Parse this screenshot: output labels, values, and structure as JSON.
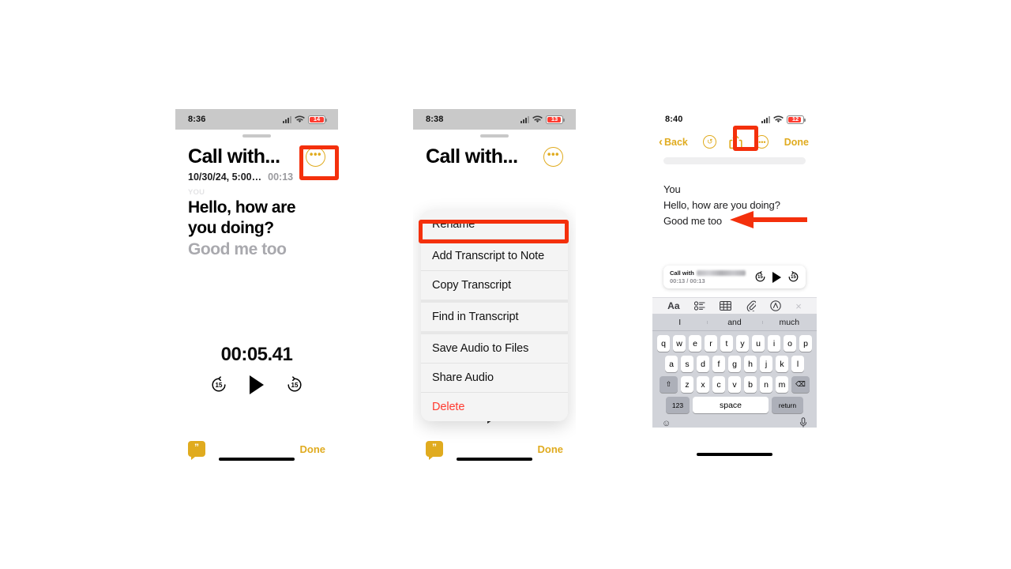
{
  "phone1": {
    "status": {
      "time": "8:36",
      "battery_level": "14"
    },
    "recording": {
      "title": "Call with...",
      "date": "10/30/24, 5:00…",
      "duration": "00:13",
      "speaker_label": "YOU",
      "transcript_spoken": "Hello, how are you doing?",
      "transcript_pending": "Good me too"
    },
    "player": {
      "current_time": "00:05.41",
      "skip_back_label": "15",
      "skip_forward_label": "15"
    },
    "bottom": {
      "done_label": "Done"
    }
  },
  "phone2": {
    "status": {
      "time": "8:38",
      "battery_level": "13"
    },
    "recording": {
      "title": "Call with..."
    },
    "menu": {
      "items": [
        {
          "label": "Rename",
          "danger": false
        },
        {
          "label": "Add Transcript to Note",
          "danger": false
        },
        {
          "label": "Copy Transcript",
          "danger": false
        },
        {
          "label": "Find in Transcript",
          "danger": false
        },
        {
          "label": "Save Audio to Files",
          "danger": false
        },
        {
          "label": "Share Audio",
          "danger": false
        },
        {
          "label": "Delete",
          "danger": true
        }
      ]
    },
    "bottom": {
      "done_label": "Done"
    }
  },
  "phone3": {
    "status": {
      "time": "8:40",
      "battery_level": "12"
    },
    "nav": {
      "back_label": "Back",
      "done_label": "Done",
      "undo_icon": "undo-icon",
      "share_icon": "share-icon",
      "more_icon": "more-icon"
    },
    "note": {
      "lines": [
        "You",
        "Hello, how are you doing?",
        "Good me too"
      ]
    },
    "audio_chip": {
      "title_prefix": "Call with",
      "time": "00:13 / 00:13",
      "skip_back_label": "15",
      "skip_forward_label": "15"
    },
    "keyboard": {
      "toolbar": [
        "Aa",
        "checklist-icon",
        "table-icon",
        "attachment-icon",
        "markup-icon",
        "close-icon"
      ],
      "suggestions": [
        "I",
        "and",
        "much"
      ],
      "row1": [
        "q",
        "w",
        "e",
        "r",
        "t",
        "y",
        "u",
        "i",
        "o",
        "p"
      ],
      "row2": [
        "a",
        "s",
        "d",
        "f",
        "g",
        "h",
        "j",
        "k",
        "l"
      ],
      "row3": [
        "z",
        "x",
        "c",
        "v",
        "b",
        "n",
        "m"
      ],
      "shift_icon": "shift-icon",
      "backspace_icon": "backspace-icon",
      "numbers_key": "123",
      "space_key": "space",
      "return_key": "return",
      "emoji_icon": "emoji-icon",
      "mic_icon": "microphone-icon"
    }
  },
  "annotations": {
    "highlight_color": "#f4300c",
    "boxes": [
      "more-button-phone1",
      "add-transcript-menu-item",
      "share-button-phone3"
    ],
    "arrows": [
      "arrow-to-good-me-too"
    ]
  }
}
